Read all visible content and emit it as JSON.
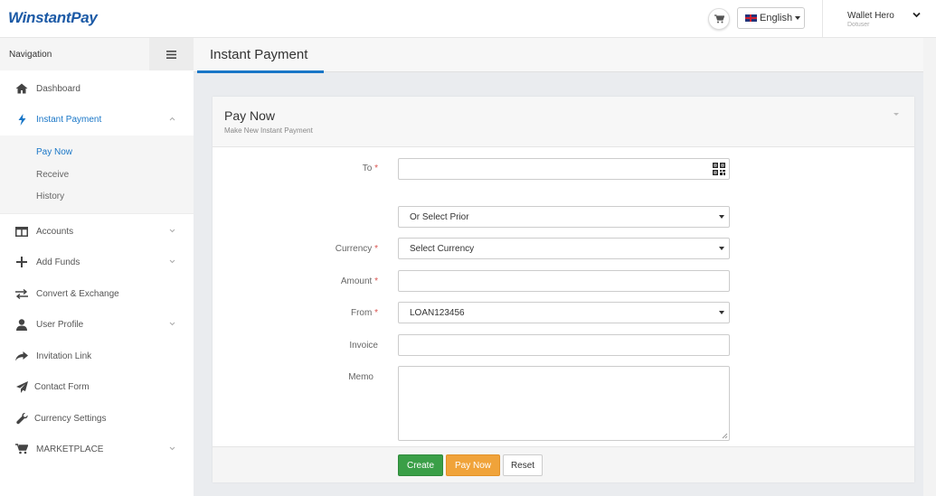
{
  "app": {
    "logo": "WinstantPay"
  },
  "topbar": {
    "language": "English",
    "user_name": "Wallet Hero",
    "user_sub": "Dotuser"
  },
  "sidebar": {
    "title": "Navigation",
    "items": [
      {
        "label": "Dashboard",
        "icon": "home-icon"
      },
      {
        "label": "Instant Payment",
        "icon": "bolt-icon",
        "active": true,
        "expanded": true
      },
      {
        "label": "Accounts",
        "icon": "columns-icon"
      },
      {
        "label": "Add Funds",
        "icon": "plus-icon"
      },
      {
        "label": "Convert & Exchange",
        "icon": "exchange-icon"
      },
      {
        "label": "User Profile",
        "icon": "user-icon"
      },
      {
        "label": "Invitation Link",
        "icon": "share-icon"
      },
      {
        "label": "Contact Form",
        "icon": "paper-plane-icon"
      },
      {
        "label": "Currency Settings",
        "icon": "wrench-icon"
      },
      {
        "label": "MARKETPLACE",
        "icon": "cart-icon"
      }
    ],
    "sub_items": [
      {
        "label": "Pay Now",
        "active": true
      },
      {
        "label": "Receive"
      },
      {
        "label": "History"
      }
    ]
  },
  "page": {
    "title": "Instant Payment"
  },
  "panel": {
    "title": "Pay Now",
    "subtitle": "Make New Instant Payment"
  },
  "form": {
    "to_label": "To",
    "prior_select": "Or Select Prior",
    "currency_label": "Currency",
    "currency_select": "Select Currency",
    "amount_label": "Amount",
    "from_label": "From",
    "from_select": "LOAN123456",
    "invoice_label": "Invoice",
    "memo_label": "Memo",
    "required_mark": "*"
  },
  "buttons": {
    "create": "Create",
    "pay_now": "Pay Now",
    "reset": "Reset"
  },
  "colors": {
    "brand": "#1c5aa6",
    "accent": "#1976c7",
    "create": "#3a9f47",
    "pay_now": "#f0a33a",
    "required": "#d9534f"
  }
}
